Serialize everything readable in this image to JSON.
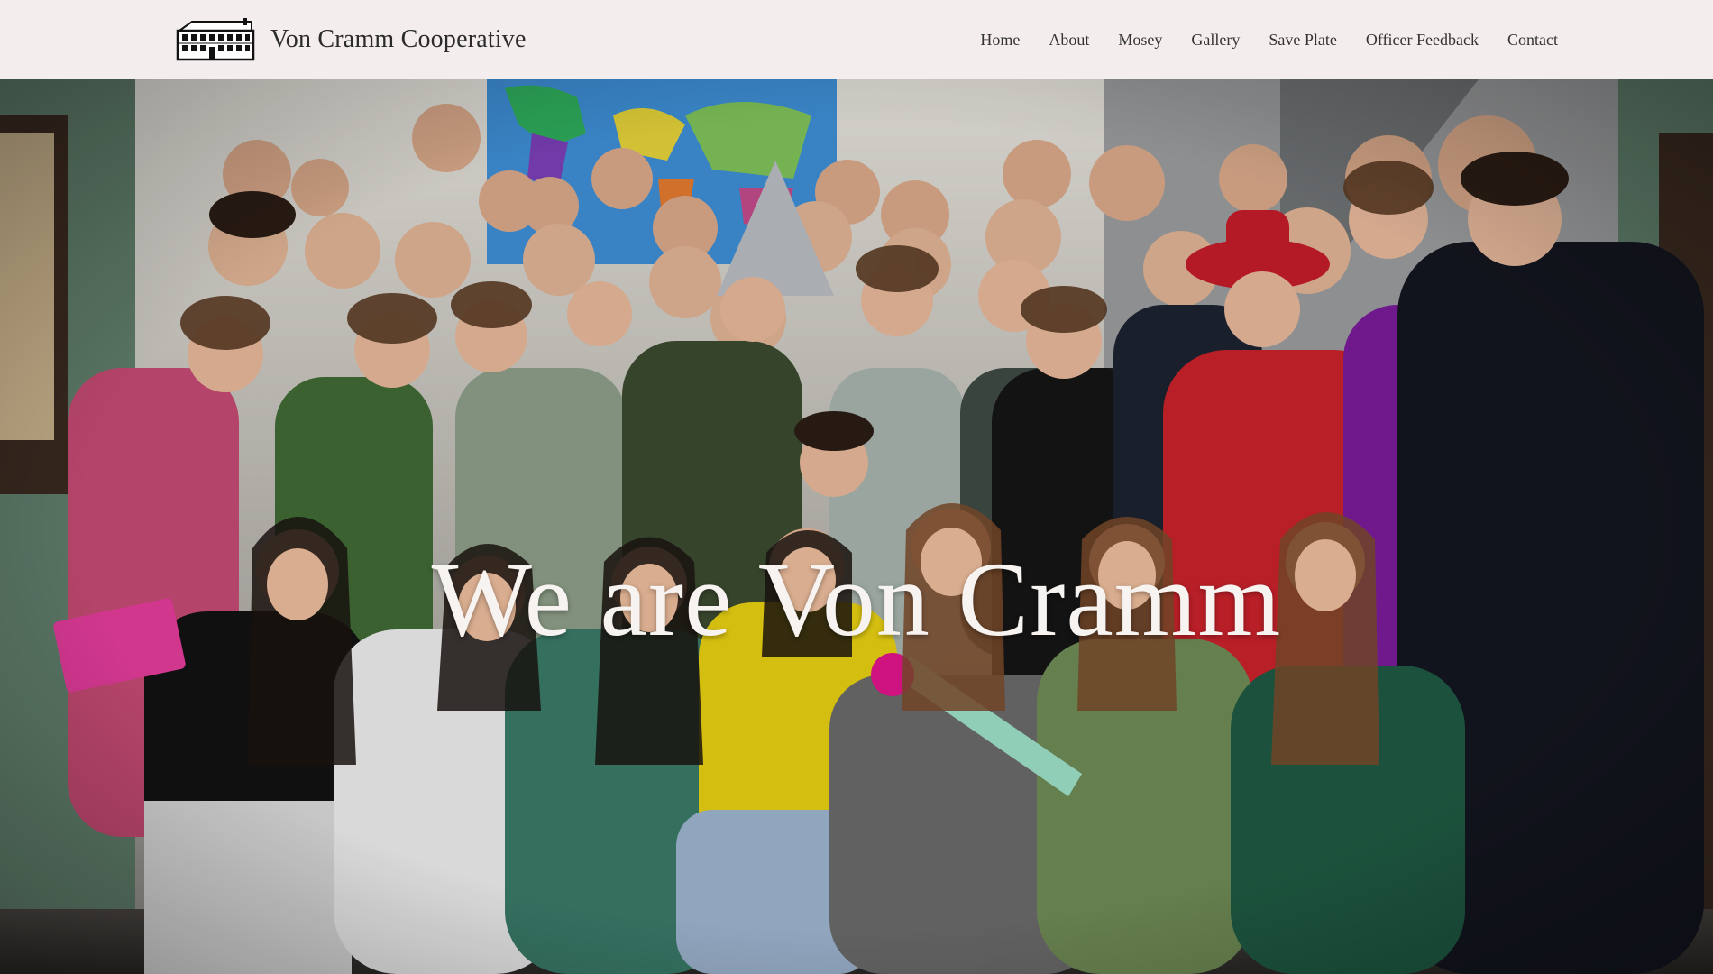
{
  "site": {
    "title": "Von Cramm Cooperative",
    "logo_icon": "house-building-icon"
  },
  "nav": {
    "items": [
      {
        "label": "Home"
      },
      {
        "label": "About"
      },
      {
        "label": "Mosey"
      },
      {
        "label": "Gallery"
      },
      {
        "label": "Save Plate"
      },
      {
        "label": "Officer Feedback"
      },
      {
        "label": "Contact"
      }
    ]
  },
  "hero": {
    "heading": "We are Von Cramm",
    "photo": "group-photo",
    "colors": {
      "header_bg": "#f3eded",
      "heading_text": "#f6f3f0"
    }
  }
}
